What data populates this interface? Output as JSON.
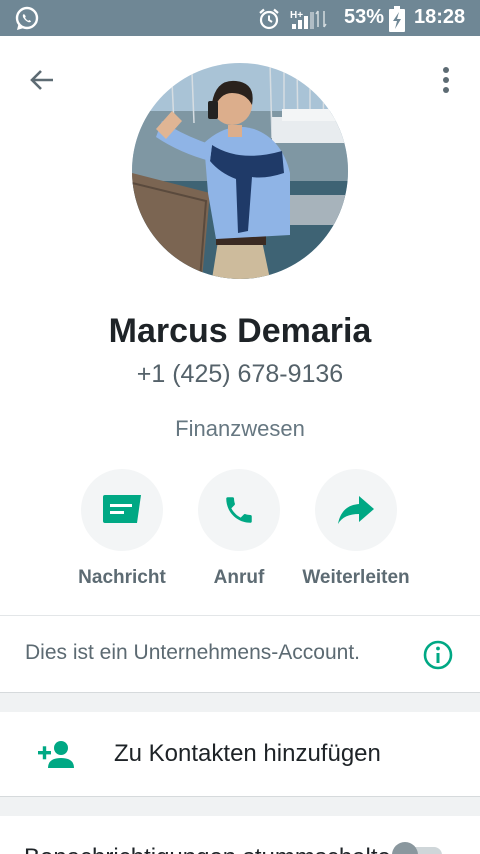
{
  "status_bar": {
    "battery_percent": "53%",
    "time": "18:28",
    "network_label": "H+",
    "icons": [
      "whatsapp-icon",
      "alarm-icon",
      "signal-icon",
      "battery-icon"
    ]
  },
  "contact": {
    "name": "Marcus Demaria",
    "phone": "+1 (425) 678-9136",
    "category": "Finanzwesen"
  },
  "actions": [
    {
      "label": "Nachricht",
      "icon": "message-icon"
    },
    {
      "label": "Anruf",
      "icon": "phone-icon"
    },
    {
      "label": "Weiterleiten",
      "icon": "forward-icon"
    }
  ],
  "business_note": "Dies ist ein Unternehmens-Account.",
  "add_contact_label": "Zu Kontakten hinzufügen",
  "notifications_label": "Benachrichtigungen stummschalten",
  "colors": {
    "accent": "#00a884",
    "status_bar": "#6f8795"
  }
}
